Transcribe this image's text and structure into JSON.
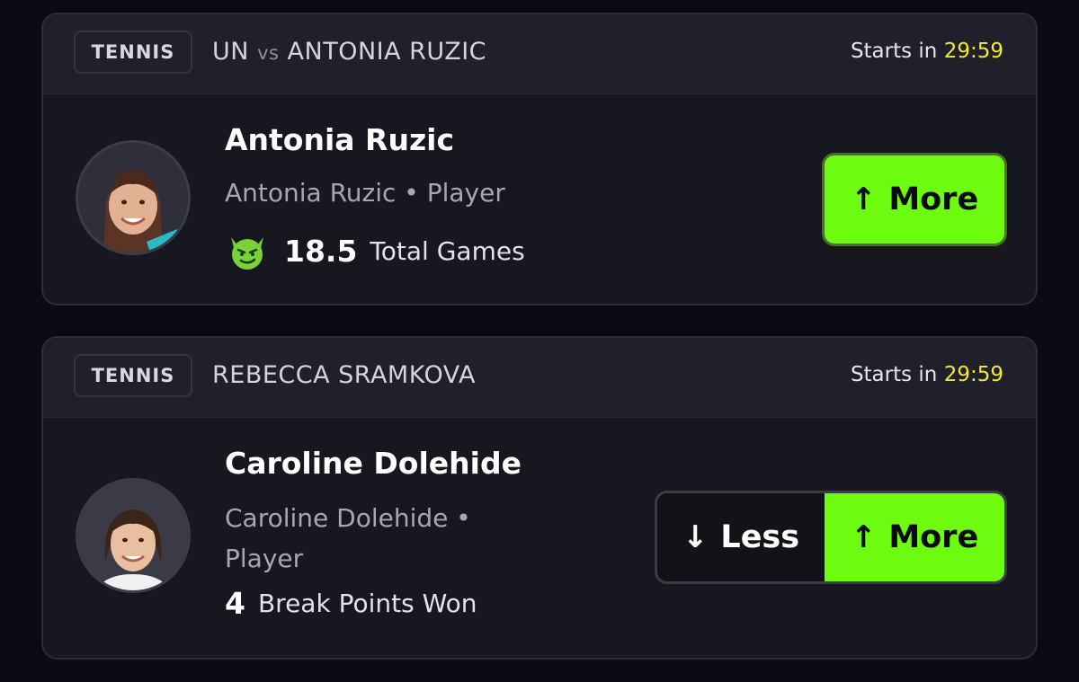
{
  "cards": [
    {
      "sport": "TENNIS",
      "matchup_left": "UN",
      "matchup_vs": "vs",
      "matchup_right": "ANTONIA RUZIC",
      "starts_label": "Starts in",
      "timer": "29:59",
      "player_name": "Antonia Ruzic",
      "player_sub": "Antonia Ruzic • Player",
      "stat_value": "18.5",
      "stat_label": "Total Games",
      "stat_icon": "demon-face-icon",
      "more_label": "More"
    },
    {
      "sport": "TENNIS",
      "matchup": "REBECCA SRAMKOVA",
      "starts_label": "Starts in",
      "timer": "29:59",
      "player_name": "Caroline Dolehide",
      "player_sub_line1": "Caroline Dolehide •",
      "player_sub_line2": "Player",
      "stat_value": "4",
      "stat_label": "Break Points Won",
      "less_label": "Less",
      "more_label": "More"
    }
  ],
  "colors": {
    "accent_green": "#6dfb0f",
    "timer_yellow": "#f3ea2f",
    "card_bg": "#16171f",
    "header_bg": "#1f2029"
  }
}
